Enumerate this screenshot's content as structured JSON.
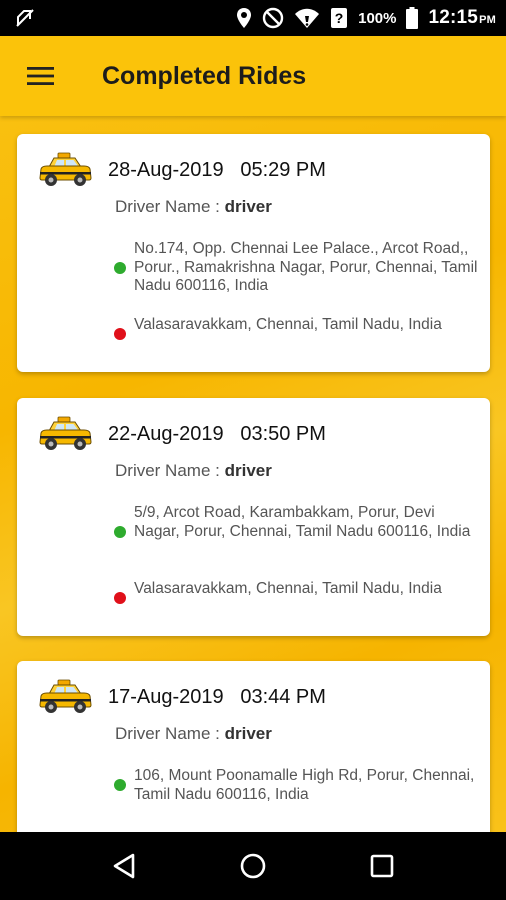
{
  "status_bar": {
    "battery_percent": "100%",
    "time": "12:15",
    "time_suffix": "PM",
    "icons": [
      "no-sim-icon",
      "location-icon",
      "do-not-disturb-icon",
      "wifi-icon",
      "notification-icon",
      "battery-icon"
    ]
  },
  "app_bar": {
    "title": "Completed Rides",
    "menu_icon": "hamburger-menu-icon"
  },
  "driver_label": "Driver Name",
  "driver_separator": ":",
  "rides": [
    {
      "date": "28-Aug-2019",
      "time": "05:29 PM",
      "driver": "driver",
      "pickup": "No.174, Opp. Chennai Lee Palace., Arcot Road,, Porur., Ramakrishna Nagar, Porur, Chennai, Tamil Nadu 600116, India",
      "drop": "Valasaravakkam, Chennai, Tamil Nadu, India"
    },
    {
      "date": "22-Aug-2019",
      "time": "03:50 PM",
      "driver": "driver",
      "pickup": "5/9, Arcot Road, Karambakkam, Porur, Devi Nagar, Porur, Chennai, Tamil Nadu 600116, India",
      "drop": "Valasaravakkam, Chennai, Tamil Nadu, India"
    },
    {
      "date": "17-Aug-2019",
      "time": "03:44 PM",
      "driver": "driver",
      "pickup": "106, Mount Poonamalle High Rd, Porur, Chennai, Tamil Nadu 600116, India",
      "drop": ""
    }
  ],
  "colors": {
    "app_bar": "#fbc30a",
    "background": "#f7b600",
    "pickup_dot": "#2eab2e",
    "drop_dot": "#e0101a"
  },
  "nav_bar": {
    "icons": [
      "back-icon",
      "home-icon",
      "recents-icon"
    ]
  }
}
